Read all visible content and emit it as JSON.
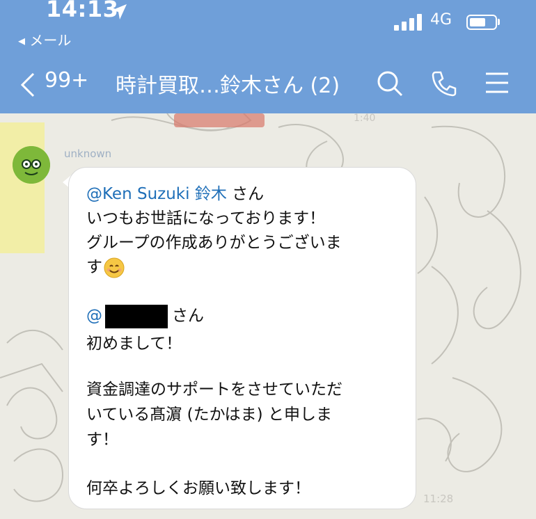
{
  "status_bar": {
    "time": "14:13",
    "back_app": "◂ メール",
    "network": "4G"
  },
  "nav": {
    "unread_count": "99+",
    "title": "時計買取…鈴木さん (2)"
  },
  "chat": {
    "prev_time": "1:40",
    "sender": "unknown",
    "message_lines": [
      "いつもお世話になっております！",
      "グループの作成ありがとうございま",
      "す",
      "さん",
      "初めまして！",
      "資金調達のサポートをさせていただ",
      "いている髙濵 (たかはま) と申しま",
      "す！",
      "何卒よろしくお願い致します！"
    ],
    "mention_1": "@Ken Suzuki 鈴木",
    "mention_1_suffix": " さん",
    "mention_2": "@",
    "time": "11:28"
  },
  "colors": {
    "header": "#6f9fd9",
    "mention": "#1f6fb8",
    "bubble": "#ffffff",
    "avatar": "#7eb83a"
  },
  "icons": [
    "location-arrow-icon",
    "signal-icon",
    "battery-icon",
    "chevron-left-icon",
    "search-icon",
    "phone-icon",
    "menu-icon",
    "smile-emoji-icon"
  ]
}
